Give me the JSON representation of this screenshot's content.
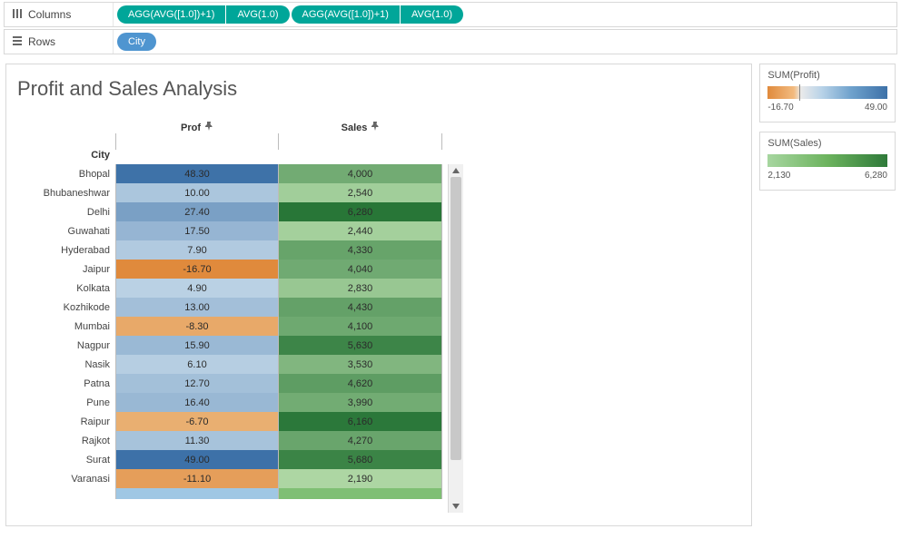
{
  "shelves": {
    "columns": {
      "label": "Columns",
      "pills": [
        {
          "group": [
            {
              "text": "AGG(AVG([1.0])+1)"
            },
            {
              "text": "AVG(1.0)"
            }
          ]
        },
        {
          "group": [
            {
              "text": "AGG(AVG([1.0])+1)"
            },
            {
              "text": "AVG(1.0)"
            }
          ]
        }
      ]
    },
    "rows": {
      "label": "Rows",
      "pills": [
        {
          "text": "City",
          "variant": "blue"
        }
      ]
    }
  },
  "viz": {
    "title": "Profit and Sales Analysis",
    "colHeaders": [
      "Prof",
      "Sales"
    ],
    "rowHeader": "City"
  },
  "legends": {
    "profit": {
      "title": "SUM(Profit)",
      "min": "-16.70",
      "max": "49.00"
    },
    "sales": {
      "title": "SUM(Sales)",
      "min": "2,130",
      "max": "6,280"
    }
  },
  "chart_data": {
    "type": "table",
    "profit_range": [
      -16.7,
      49.0
    ],
    "sales_range": [
      2130,
      6280
    ],
    "rows": [
      {
        "city": "Bhopal",
        "profit": 48.3,
        "sales": 4000
      },
      {
        "city": "Bhubaneshwar",
        "profit": 10.0,
        "sales": 2540
      },
      {
        "city": "Delhi",
        "profit": 27.4,
        "sales": 6280
      },
      {
        "city": "Guwahati",
        "profit": 17.5,
        "sales": 2440
      },
      {
        "city": "Hyderabad",
        "profit": 7.9,
        "sales": 4330
      },
      {
        "city": "Jaipur",
        "profit": -16.7,
        "sales": 4040
      },
      {
        "city": "Kolkata",
        "profit": 4.9,
        "sales": 2830
      },
      {
        "city": "Kozhikode",
        "profit": 13.0,
        "sales": 4430
      },
      {
        "city": "Mumbai",
        "profit": -8.3,
        "sales": 4100
      },
      {
        "city": "Nagpur",
        "profit": 15.9,
        "sales": 5630
      },
      {
        "city": "Nasik",
        "profit": 6.1,
        "sales": 3530
      },
      {
        "city": "Patna",
        "profit": 12.7,
        "sales": 4620
      },
      {
        "city": "Pune",
        "profit": 16.4,
        "sales": 3990
      },
      {
        "city": "Raipur",
        "profit": -6.7,
        "sales": 6160
      },
      {
        "city": "Rajkot",
        "profit": 11.3,
        "sales": 4270
      },
      {
        "city": "Surat",
        "profit": 49.0,
        "sales": 5680
      },
      {
        "city": "Varanasi",
        "profit": -11.1,
        "sales": 2190
      }
    ]
  }
}
